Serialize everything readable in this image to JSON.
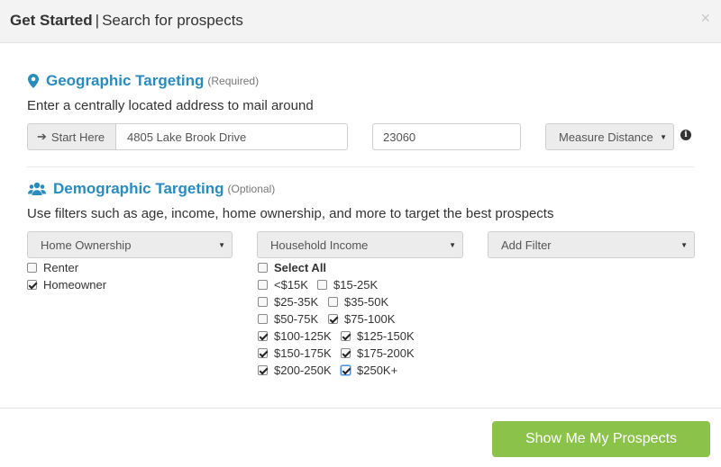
{
  "header": {
    "title_bold": "Get Started",
    "title_rest": "Search for prospects",
    "close_glyph": "×"
  },
  "geo": {
    "title": "Geographic Targeting",
    "required": "(Required)",
    "description": "Enter a centrally located address to mail around",
    "start_label": "Start Here",
    "address_value": "4805 Lake Brook Drive",
    "zip_value": "23060",
    "distance_select": "Measure Distance",
    "info_glyph": "i"
  },
  "demo": {
    "title": "Demographic Targeting",
    "optional": "(Optional)",
    "description": "Use filters such as age, income, home ownership, and more to target the best prospects",
    "filters": {
      "home_ownership": "Home Ownership",
      "household_income": "Household Income",
      "add_filter": "Add Filter"
    },
    "ownership_options": [
      {
        "label": "Renter",
        "checked": false
      },
      {
        "label": "Homeowner",
        "checked": true
      }
    ],
    "income_select_all": {
      "label": "Select All",
      "checked": false
    },
    "income_options": [
      {
        "label": "<$15K",
        "checked": false
      },
      {
        "label": "$15-25K",
        "checked": false
      },
      {
        "label": "$25-35K",
        "checked": false
      },
      {
        "label": "$35-50K",
        "checked": false
      },
      {
        "label": "$50-75K",
        "checked": false
      },
      {
        "label": "$75-100K",
        "checked": true
      },
      {
        "label": "$100-125K",
        "checked": true
      },
      {
        "label": "$125-150K",
        "checked": true
      },
      {
        "label": "$150-175K",
        "checked": true
      },
      {
        "label": "$175-200K",
        "checked": true
      },
      {
        "label": "$200-250K",
        "checked": true
      },
      {
        "label": "$250K+",
        "checked": true
      }
    ]
  },
  "footer": {
    "submit_label": "Show Me My Prospects"
  },
  "colors": {
    "accent": "#2a8bbd",
    "submit": "#8bc34a"
  }
}
